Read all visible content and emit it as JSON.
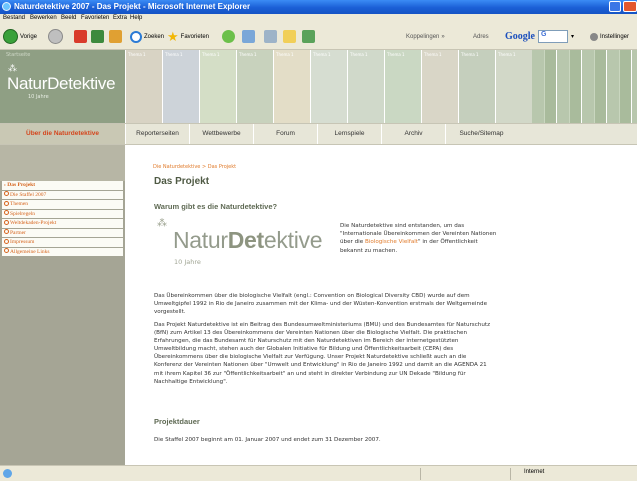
{
  "window": {
    "title": "Naturdetektive 2007 - Das Projekt - Microsoft Internet Explorer"
  },
  "menubar": [
    "Bestand",
    "Bewerken",
    "Beeld",
    "Favorieten",
    "Extra",
    "Help"
  ],
  "toolbar": {
    "back_label": "Vorige",
    "search_label": "Zoeken",
    "favorites_label": "Favorieten",
    "links_label": "Koppelingen",
    "address_label": "Adres",
    "google_label": "Google",
    "google_box": "G",
    "settings_label": "Instellinger"
  },
  "site": {
    "logo_tag": "Startseite",
    "logo_main_light": "Natur",
    "logo_main_bold": "Detektive",
    "logo_sub": "10 Jahre",
    "thumb_label": "Thema 1"
  },
  "nav": {
    "about": "Über die Naturdetektive",
    "items": [
      "Reporterseiten",
      "Wettbewerbe",
      "Forum",
      "Lernspiele",
      "Archiv",
      "Suche/Sitemap"
    ]
  },
  "sidebar": {
    "items": [
      {
        "label": "Das Projekt",
        "active": true,
        "marker": "›"
      },
      {
        "label": "Die Staffel 2007",
        "active": false,
        "marker": "o"
      },
      {
        "label": "Themen",
        "active": false,
        "marker": "o"
      },
      {
        "label": "Spielregeln",
        "active": false,
        "marker": "o"
      },
      {
        "label": "Weltdekaden-Projekt",
        "active": false,
        "marker": "o"
      },
      {
        "label": "Partner",
        "active": false,
        "marker": "o"
      },
      {
        "label": "Impressum",
        "active": false,
        "marker": "o"
      },
      {
        "label": "Allgemeine Links",
        "active": false,
        "marker": "o"
      }
    ]
  },
  "content": {
    "breadcrumb": "Die Naturdetektive > Das Projekt",
    "title": "Das Projekt",
    "heading1": "Warum gibt es die Naturdetektive?",
    "biglogo_light": "Natur",
    "biglogo_bold": "Det",
    "biglogo_rest": "ektive",
    "biglogo_years": "10 Jahre",
    "logo_text_1": "Die Naturdetektive sind entstanden, um das \"Internationale Übereinkommen der Vereinten Nationen über die ",
    "logo_text_link": "Biologische Vielfalt",
    "logo_text_2": "\" in der Öffentlichkeit bekannt zu machen.",
    "para1": "Das Übereinkommen über die biologische Vielfalt (engl.: Convention on Biological Diversity CBD) wurde auf dem Umweltgipfel 1992 in Rio de Janeiro zusammen mit der Klima- und der Wüsten-Konvention erstmals der Weltgemeinde vorgestellt.",
    "para2": "Das Projekt Naturdetektive ist ein Beitrag des Bundesumweltministeriums (BMU) und des Bundesamtes für Naturschutz (BfN) zum Artikel 13 des Übereinkommens der Vereinten Nationen über die Biologische Vielfalt. Die praktischen Erfahrungen, die das Bundesamt für Naturschutz mit den Naturdetektiven im Bereich der internetgestützten Umweltbildung macht, stehen auch der Globalen Initiative für Bildung und Öffentlichkeitsarbeit (CEPA) des Übereinkommens über die biologische Vielfalt zur Verfügung. Unser Projekt Naturdetektive schließt auch an die Konferenz der Vereinten Nationen über \"Umwelt und Entwicklung\" in Rio de Janeiro 1992 und damit an die AGENDA 21 mit ihrem Kapitel 36 zur \"Öffentlichkeitsarbeit\" an und steht in direkter Verbindung zur UN Dekade \"Bildung für Nachhaltige Entwicklung\".",
    "heading2": "Projektdauer",
    "para3": "Die Staffel 2007 beginnt am 01. Januar 2007 und endet zum 31 Dezember 2007."
  },
  "statusbar": {
    "zone": "Internet"
  },
  "colors": {
    "accent_orange": "#e07a2a",
    "sidebar_bg": "#a5a595",
    "nav_bg": "#e7e6d8",
    "title_blue": "#1b5fd6"
  }
}
